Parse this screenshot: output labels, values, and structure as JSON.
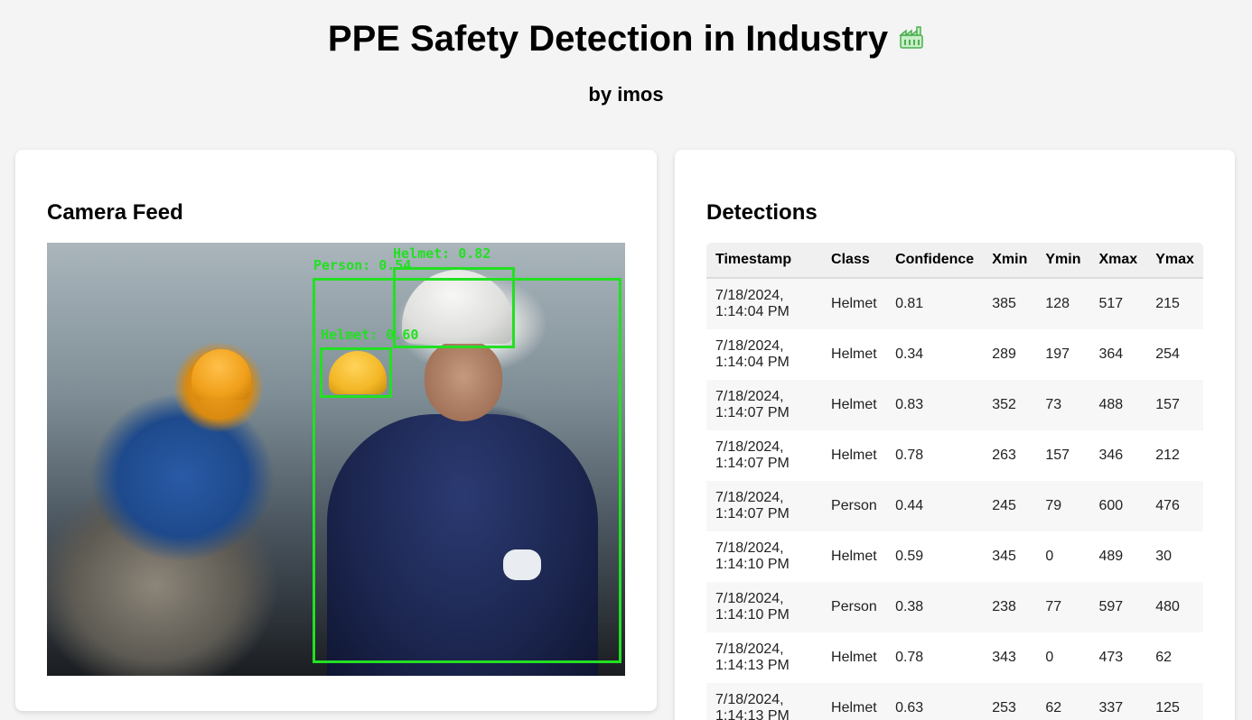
{
  "header": {
    "title": "PPE Safety Detection in Industry",
    "title_icon": "factory-icon",
    "subtitle": "by imos"
  },
  "camera": {
    "title": "Camera Feed",
    "overlays": [
      {
        "label": "Helmet: 0.82",
        "class": "Helmet"
      },
      {
        "label": "Person: 0.54",
        "class": "Person"
      },
      {
        "label": "Helmet: 0.60",
        "class": "Helmet"
      }
    ],
    "box_color": "#22e022"
  },
  "detections": {
    "title": "Detections",
    "columns": [
      "Timestamp",
      "Class",
      "Confidence",
      "Xmin",
      "Ymin",
      "Xmax",
      "Ymax"
    ],
    "rows": [
      {
        "timestamp": "7/18/2024,\n1:14:04 PM",
        "class": "Helmet",
        "confidence": "0.81",
        "xmin": "385",
        "ymin": "128",
        "xmax": "517",
        "ymax": "215"
      },
      {
        "timestamp": "7/18/2024,\n1:14:04 PM",
        "class": "Helmet",
        "confidence": "0.34",
        "xmin": "289",
        "ymin": "197",
        "xmax": "364",
        "ymax": "254"
      },
      {
        "timestamp": "7/18/2024,\n1:14:07 PM",
        "class": "Helmet",
        "confidence": "0.83",
        "xmin": "352",
        "ymin": "73",
        "xmax": "488",
        "ymax": "157"
      },
      {
        "timestamp": "7/18/2024,\n1:14:07 PM",
        "class": "Helmet",
        "confidence": "0.78",
        "xmin": "263",
        "ymin": "157",
        "xmax": "346",
        "ymax": "212"
      },
      {
        "timestamp": "7/18/2024,\n1:14:07 PM",
        "class": "Person",
        "confidence": "0.44",
        "xmin": "245",
        "ymin": "79",
        "xmax": "600",
        "ymax": "476"
      },
      {
        "timestamp": "7/18/2024,\n1:14:10 PM",
        "class": "Helmet",
        "confidence": "0.59",
        "xmin": "345",
        "ymin": "0",
        "xmax": "489",
        "ymax": "30"
      },
      {
        "timestamp": "7/18/2024,\n1:14:10 PM",
        "class": "Person",
        "confidence": "0.38",
        "xmin": "238",
        "ymin": "77",
        "xmax": "597",
        "ymax": "480"
      },
      {
        "timestamp": "7/18/2024,\n1:14:13 PM",
        "class": "Helmet",
        "confidence": "0.78",
        "xmin": "343",
        "ymin": "0",
        "xmax": "473",
        "ymax": "62"
      },
      {
        "timestamp": "7/18/2024,\n1:14:13 PM",
        "class": "Helmet",
        "confidence": "0.63",
        "xmin": "253",
        "ymin": "62",
        "xmax": "337",
        "ymax": "125"
      }
    ]
  }
}
